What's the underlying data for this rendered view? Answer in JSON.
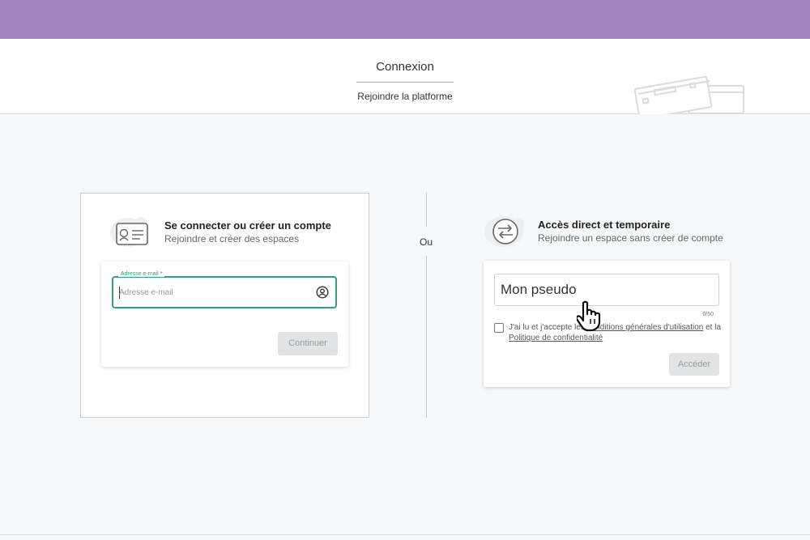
{
  "header": {
    "title": "Connexion",
    "subtitle": "Rejoindre la platforme"
  },
  "login": {
    "title": "Se connecter ou créer un compte",
    "subtitle": "Rejoindre et créer des espaces",
    "email_label": "Adresse e-mail *",
    "email_placeholder": "Adresse e-mail",
    "email_value": "",
    "continue_label": "Continuer"
  },
  "separator": {
    "label": "Ou"
  },
  "guest": {
    "title": "Accès direct et temporaire",
    "subtitle": "Rejoindre un espace sans créer de compte",
    "pseudo_value": "Mon pseudo",
    "counter": "0/50",
    "terms_prefix": "J'ai lu et j'accepte les ",
    "terms_link": "conditions générales d'utilisation",
    "terms_middle": " et la ",
    "privacy_link": "Politique de confidentialité",
    "checkbox_checked": false,
    "access_label": "Accéder"
  },
  "colors": {
    "top_bar": "#a083be",
    "focus_green": "#2aa57a",
    "disabled_button": "#e2e3e4"
  }
}
